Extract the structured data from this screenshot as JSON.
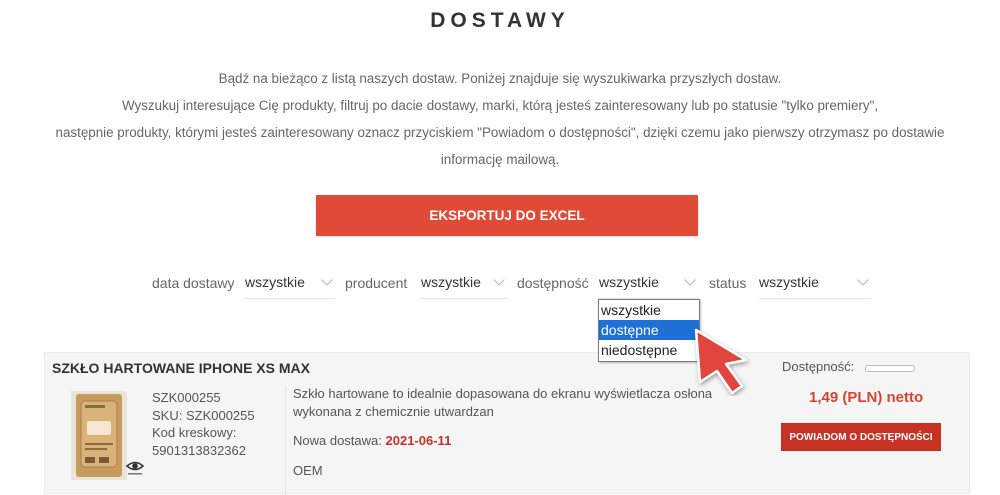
{
  "page": {
    "title": "DOSTAWY",
    "intro": [
      "Bądź na bieżąco z listą naszych dostaw. Poniżej znajduje się wyszukiwarka przyszłych dostaw.",
      "Wyszukuj interesujące Cię produkty, filtruj po dacie dostawy, marki, którą jesteś zainteresowany lub po statusie \"tylko premiery\",",
      "następnie produkty, którymi jesteś zainteresowany oznacz przyciskiem \"Powiadom o dostępności\", dzięki czemu jako pierwszy otrzymasz po dostawie",
      "informację mailową."
    ],
    "export_button": "EKSPORTUJ DO EXCEL"
  },
  "filters": [
    {
      "label": "data dostawy",
      "value": "wszystkie"
    },
    {
      "label": "producent",
      "value": "wszystkie"
    },
    {
      "label": "dostępność",
      "value": "wszystkie"
    },
    {
      "label": "status",
      "value": "wszystkie"
    }
  ],
  "dropdown": {
    "options": [
      "wszystkie",
      "dostępne",
      "niedostępne"
    ],
    "highlighted_index": 1
  },
  "product": {
    "name": "SZKŁO HARTOWANE IPHONE XS MAX",
    "availability_label": "Dostępność:",
    "code": "SZK000255",
    "sku": "SKU: SZK000255",
    "barcode_label": "Kod kreskowy:",
    "barcode": "5901313832362",
    "description": "Szkło hartowane to idealnie dopasowana do ekranu wyświetlacza osłona wykonana z chemicznie utwardzan",
    "delivery_label": "Nowa dostawa:",
    "delivery_date": "2021-06-11",
    "brand": "OEM",
    "price": "1,49 (PLN) netto",
    "notify_button": "POWIADOM O DOSTĘPNOŚCI"
  },
  "colors": {
    "accent": "#e04b38",
    "notify": "#c83224",
    "highlight": "#1e6fd6",
    "price": "#d3452f"
  }
}
